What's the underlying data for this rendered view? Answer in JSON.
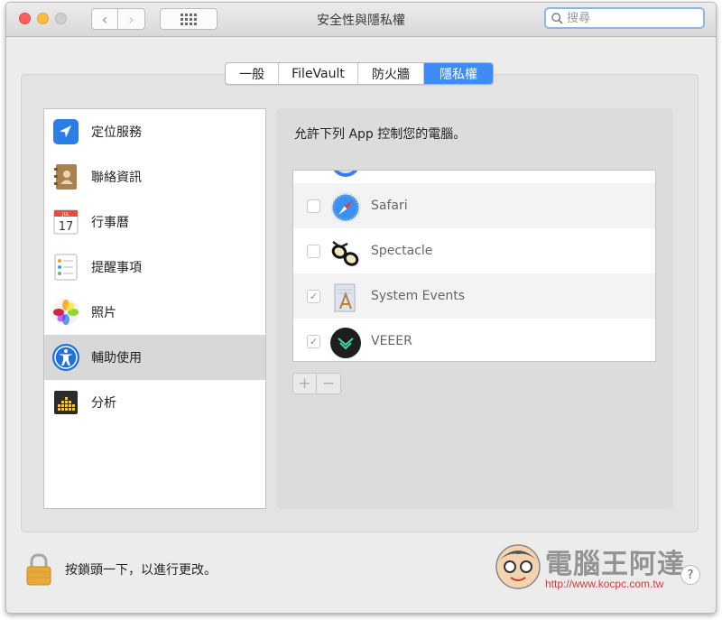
{
  "window": {
    "title": "安全性與隱私權"
  },
  "search": {
    "placeholder": "搜尋"
  },
  "tabs": [
    {
      "label": "一般"
    },
    {
      "label": "FileVault"
    },
    {
      "label": "防火牆"
    },
    {
      "label": "隱私權",
      "active": true
    }
  ],
  "sidebar": {
    "selected_index": 5,
    "items": [
      {
        "label": "定位服務",
        "icon": "location-arrow-icon"
      },
      {
        "label": "聯絡資訊",
        "icon": "contacts-book-icon"
      },
      {
        "label": "行事曆",
        "icon": "calendar-icon"
      },
      {
        "label": "提醒事項",
        "icon": "reminders-list-icon"
      },
      {
        "label": "照片",
        "icon": "photos-flower-icon"
      },
      {
        "label": "輔助使用",
        "icon": "accessibility-icon"
      },
      {
        "label": "分析",
        "icon": "analytics-chart-icon"
      }
    ]
  },
  "main": {
    "heading": "允許下列 App 控制您的電腦。",
    "apps": [
      {
        "name": "Safari",
        "checked": false,
        "icon": "safari-compass-icon"
      },
      {
        "name": "Spectacle",
        "checked": false,
        "icon": "spectacle-glasses-icon"
      },
      {
        "name": "System Events",
        "checked": true,
        "icon": "system-events-icon"
      },
      {
        "name": "VEEER",
        "checked": true,
        "icon": "veeer-icon"
      }
    ],
    "add_label": "+",
    "remove_label": "−"
  },
  "footer": {
    "lock_text": "按鎖頭一下，以進行更改。",
    "help_label": "?"
  },
  "watermark": {
    "title": "電腦王阿達",
    "url": "http://www.kocpc.com.tw"
  },
  "colors": {
    "accent": "#3e8bf6",
    "selected_row": "#d8d8d8"
  }
}
